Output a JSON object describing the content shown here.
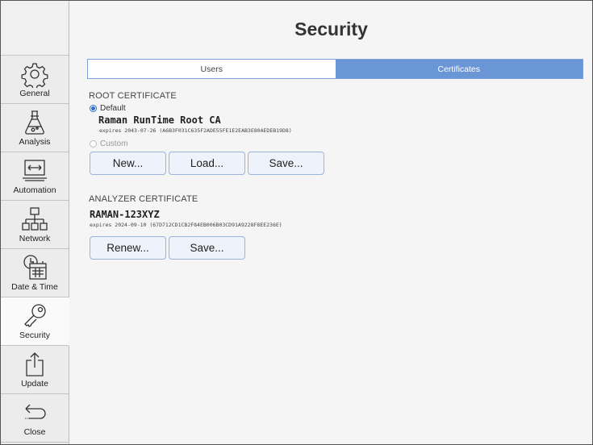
{
  "header": {
    "title": "Security"
  },
  "sidebar": {
    "items": [
      {
        "label": "General",
        "icon": "gear-icon"
      },
      {
        "label": "Analysis",
        "icon": "flask-icon"
      },
      {
        "label": "Automation",
        "icon": "monitor-arrows-icon"
      },
      {
        "label": "Network",
        "icon": "network-icon"
      },
      {
        "label": "Date & Time",
        "icon": "calendar-clock-icon"
      },
      {
        "label": "Security",
        "icon": "key-icon",
        "active": true
      },
      {
        "label": "Update",
        "icon": "upload-icon"
      },
      {
        "label": "Close",
        "icon": "return-icon"
      }
    ]
  },
  "tabs": [
    {
      "label": "Users",
      "active": false
    },
    {
      "label": "Certificates",
      "active": true
    }
  ],
  "root_certificate": {
    "heading": "ROOT CERTIFICATE",
    "default_option": {
      "label": "Default",
      "selected": true
    },
    "name": "Raman RunTime Root CA",
    "expiry": "expires 2043-07-26 (A6B3F031C635F2ADE55FE1E2EAB3E80AEDEB19D8)",
    "custom_option": {
      "label": "Custom",
      "selected": false
    },
    "buttons": {
      "new": "New...",
      "load": "Load...",
      "save": "Save..."
    }
  },
  "analyzer_certificate": {
    "heading": "ANALYZER CERTIFICATE",
    "name": "RAMAN-123XYZ",
    "expiry": "expires 2024-09-10 (67D712CD1CB2F84EB006B03CD91A9228F8EE236E)",
    "buttons": {
      "renew": "Renew...",
      "save": "Save..."
    }
  },
  "colors": {
    "accent": "#6b96d6",
    "button_border": "#9ab4dc",
    "button_bg": "#eef2fb"
  }
}
